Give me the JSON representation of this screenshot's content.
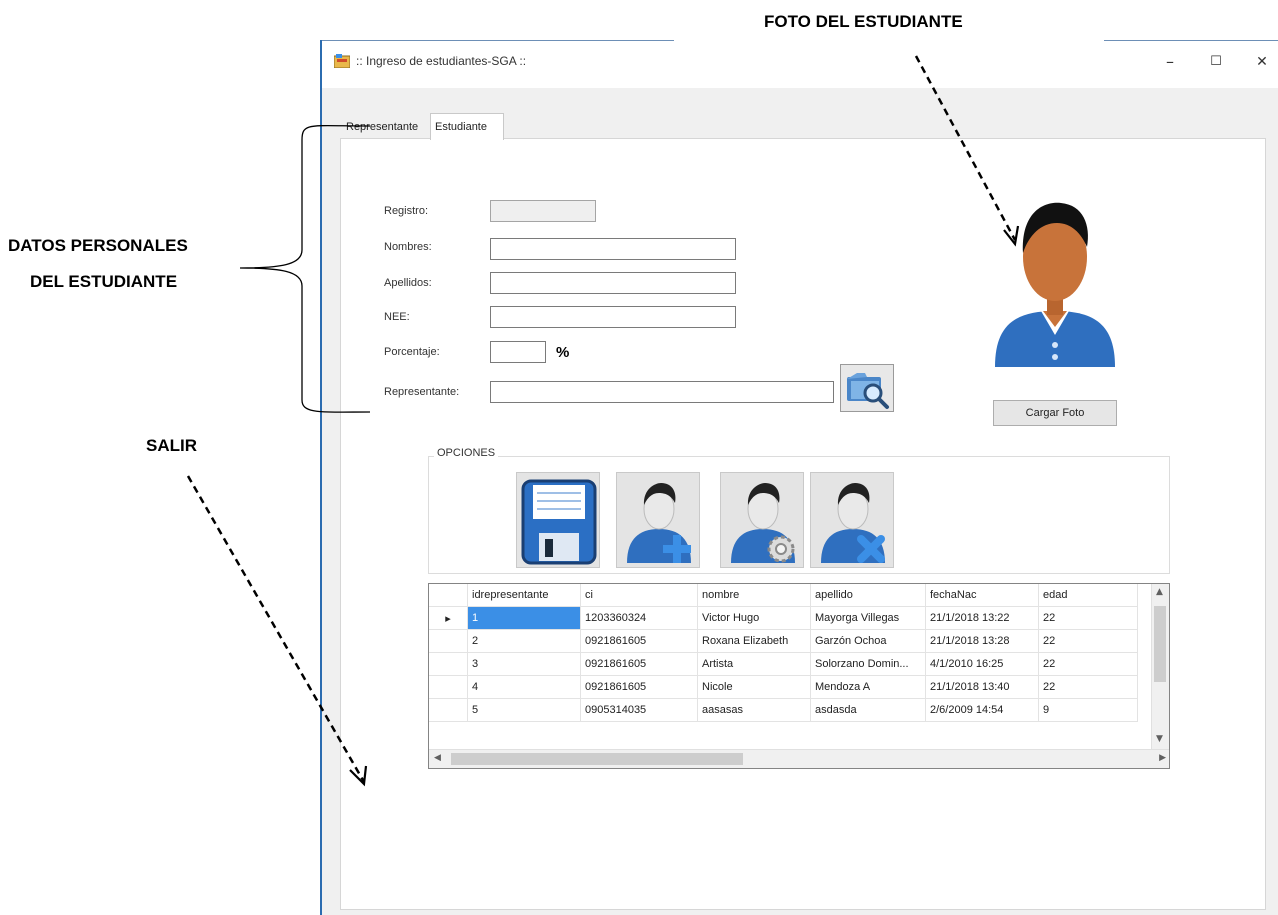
{
  "annotations": {
    "foto": "FOTO DEL ESTUDIANTE",
    "datos_line1": "DATOS PERSONALES",
    "datos_line2": "DEL ESTUDIANTE",
    "salir": "SALIR"
  },
  "window": {
    "title": ":: Ingreso de estudiantes-SGA ::",
    "controls": {
      "minimize": "–",
      "maximize": "☐",
      "close": "✕"
    }
  },
  "tabs": [
    {
      "label": "Representante",
      "selected": false
    },
    {
      "label": "Estudiante",
      "selected": true
    }
  ],
  "form": {
    "registro_label": "Registro:",
    "registro_value": "",
    "nombres_label": "Nombres:",
    "nombres_value": "",
    "apellidos_label": "Apellidos:",
    "apellidos_value": "",
    "nee_label": "NEE:",
    "nee_value": "",
    "porcentaje_label": "Porcentaje:",
    "porcentaje_value": "",
    "porcentaje_suffix": "%",
    "representante_label": "Representante:",
    "representante_value": "",
    "search_icon": "folder-search-icon"
  },
  "photo": {
    "icon": "student-avatar-icon",
    "load_button": "Cargar Foto"
  },
  "options": {
    "label": "OPCIONES",
    "buttons": [
      "save-icon",
      "add-user-icon",
      "edit-user-icon",
      "delete-user-icon"
    ]
  },
  "grid": {
    "columns": [
      "idrepresentante",
      "ci",
      "nombre",
      "apellido",
      "fechaNac",
      "edad"
    ],
    "rows": [
      [
        "1",
        "1203360324",
        "Victor Hugo",
        "Mayorga Villegas",
        "21/1/2018 13:22",
        "22"
      ],
      [
        "2",
        "0921861605",
        "Roxana Elizabeth",
        "Garzón Ochoa",
        "21/1/2018 13:28",
        "22"
      ],
      [
        "3",
        "0921861605",
        "Artista",
        "Solorzano Domin...",
        "4/1/2010 16:25",
        "22"
      ],
      [
        "4",
        "0921861605",
        "Nicole",
        "Mendoza A",
        "21/1/2018 13:40",
        "22"
      ],
      [
        "5",
        "0905314035",
        "aasasas",
        "asdasda",
        "2/6/2009 14:54",
        "9"
      ]
    ],
    "selected_row": 0
  },
  "colors": {
    "accent": "#3b8fe6",
    "window_edge": "#2b6cb0",
    "avatar_shirt": "#2f6fbf",
    "avatar_skin": "#c8733a"
  }
}
